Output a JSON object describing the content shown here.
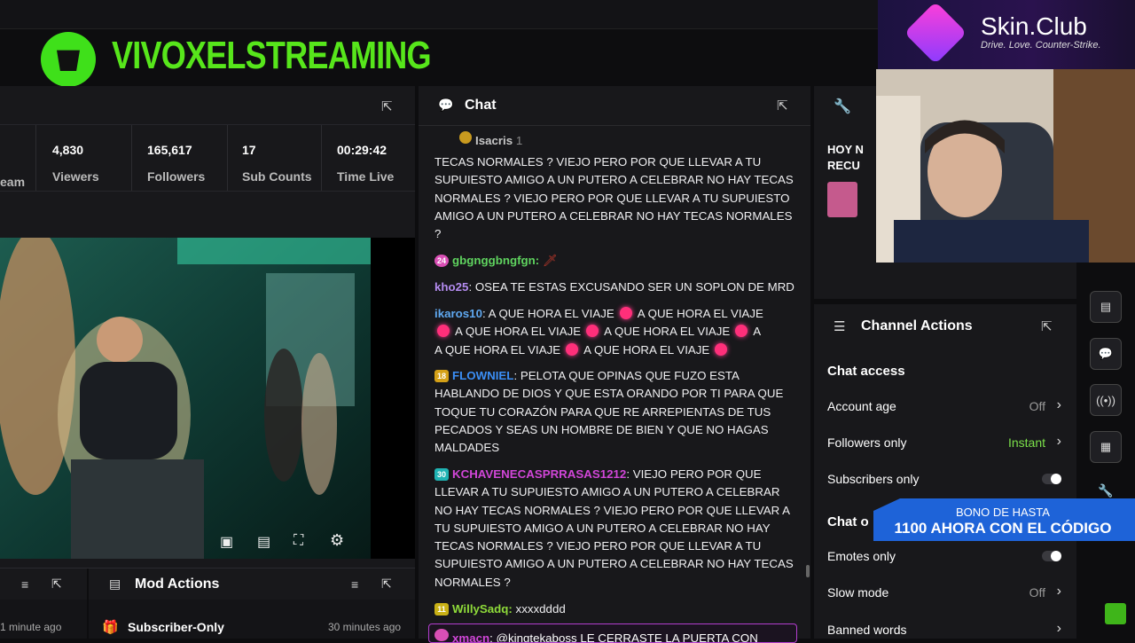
{
  "brand": {
    "title": "VIVOXELSTREAMING"
  },
  "stats": {
    "cut_label": "eam",
    "viewers": {
      "value": "4,830",
      "label": "Viewers"
    },
    "followers": {
      "value": "165,617",
      "label": "Followers"
    },
    "subs": {
      "value": "17",
      "label": "Sub Counts"
    },
    "time": {
      "value": "00:29:42",
      "label": "Time Live"
    }
  },
  "chat": {
    "title": "Chat",
    "messages": [
      {
        "user": "Isacris",
        "badge": "1",
        "text": ""
      },
      {
        "user": "",
        "text": "TECAS NORMALES ? VIEJO PERO POR QUE LLEVAR A TU SUPUIESTO AMIGO A UN PUTERO A CELEBRAR NO HAY TECAS NORMALES ? VIEJO PERO POR QUE LLEVAR A TU SUPUIESTO AMIGO A UN PUTERO A CELEBRAR NO HAY TECAS NORMALES ?"
      },
      {
        "user": "gbgnggbngfgn:",
        "badge": "24",
        "text": ""
      },
      {
        "user": "kho25",
        "text": ": OSEA TE ESTAS EXCUSANDO SER UN SOPLON DE MRD"
      },
      {
        "user": "ikaros10",
        "text_parts": [
          ": A QUE HORA EL VIAJE",
          "A QUE HORA EL VIAJE",
          "A QUE HORA EL VIAJE",
          "A QUE HORA EL VIAJE",
          "A QUE HORA EL VIAJE",
          "A QUE HORA EL VIAJE"
        ]
      },
      {
        "user": "FLOWNIEL",
        "badge": "18",
        "text": ": PELOTA QUE OPINAS QUE FUZO ESTA HABLANDO DE DIOS Y QUE ESTA ORANDO POR TI PARA QUE TOQUE TU CORAZÓN PARA QUE RE ARREPIENTAS DE TUS PECADOS Y SEAS UN HOMBRE DE BIEN Y QUE NO HAGAS MALDADES"
      },
      {
        "user": "KCHAVENECASPRRASAS1212",
        "badge": "30",
        "text": ": VIEJO PERO POR QUE LLEVAR A TU SUPUIESTO AMIGO A UN PUTERO A CELEBRAR NO HAY TECAS NORMALES ? VIEJO PERO POR QUE LLEVAR A TU SUPUIESTO AMIGO A UN PUTERO A CELEBRAR NO HAY TECAS NORMALES ? VIEJO PERO POR QUE LLEVAR A TU SUPUIESTO AMIGO A UN PUTERO A CELEBRAR NO HAY TECAS NORMALES ?"
      },
      {
        "user": "WillySadq:",
        "badge": "11",
        "text": " xxxxdddd"
      },
      {
        "user": "xmacn",
        "text": ": @kingtekaboss LE CERRASTE LA PUERTA CON"
      }
    ]
  },
  "mod_actions": {
    "title": "Mod Actions",
    "time_left": "1 minute ago",
    "item": "Subscriber-Only",
    "time_right": "30 minutes ago"
  },
  "channel_actions": {
    "title": "Channel Actions",
    "chat_access": "Chat access",
    "account_age": {
      "label": "Account age",
      "value": "Off"
    },
    "followers_only": {
      "label": "Followers only",
      "value": "Instant"
    },
    "subscribers_only": {
      "label": "Subscribers only"
    },
    "chat_other": "Chat o",
    "emotes_only": {
      "label": "Emotes only"
    },
    "slow_mode": {
      "label": "Slow mode",
      "value": "Off"
    },
    "banned_words": {
      "label": "Banned words"
    }
  },
  "partial_panel": {
    "line1": "HOY N",
    "line2": "RECU"
  },
  "sponsor": {
    "name": "Skin.Club",
    "tagline": "Drive. Love. Counter-Strike."
  },
  "promo": {
    "line1": "BONO DE HASTA",
    "line2": "1100 AHORA CON EL CÓDIGO"
  },
  "colors": {
    "brand_green": "#57e61b",
    "followers_only_value": "#7be04a",
    "accent": "#3fe01a"
  }
}
